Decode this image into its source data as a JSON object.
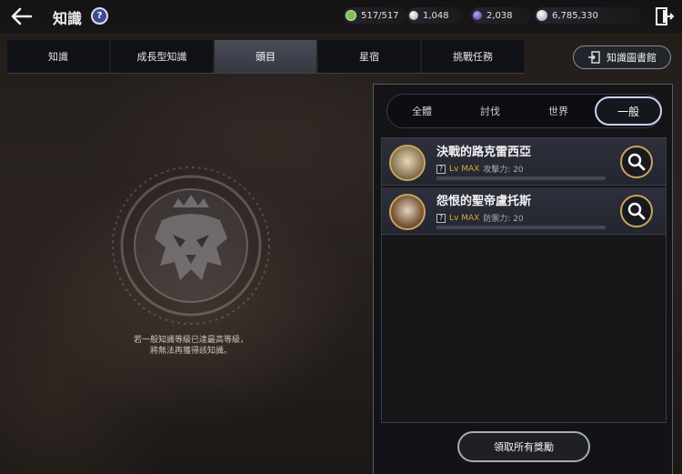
{
  "header": {
    "title": "知識",
    "help_glyph": "?"
  },
  "resources": [
    {
      "name": "energy",
      "value": "517/517",
      "color": "#7fbf5a"
    },
    {
      "name": "pearl",
      "value": "1,048",
      "color": "#d8d8d8"
    },
    {
      "name": "crystal",
      "value": "2,038",
      "color": "#6a4fc4"
    },
    {
      "name": "silver",
      "value": "6,785,330",
      "color": "#b8c4d8"
    }
  ],
  "tabs": [
    {
      "label": "知識",
      "active": false
    },
    {
      "label": "成長型知識",
      "active": false
    },
    {
      "label": "頭目",
      "active": true
    },
    {
      "label": "星宿",
      "active": false
    },
    {
      "label": "挑戰任務",
      "active": false
    }
  ],
  "library_button": "知識圖書館",
  "notice": {
    "line1": "若一般知識等級已達最高等級，",
    "line2": "將無法再獲得該知識。"
  },
  "filters": [
    {
      "label": "全體",
      "active": false
    },
    {
      "label": "討伐",
      "active": false
    },
    {
      "label": "世界",
      "active": false
    },
    {
      "label": "一般",
      "active": true
    }
  ],
  "bosses": [
    {
      "name": "決戰的路克雷西亞",
      "level": "Lv MAX",
      "stat": "攻擊力: 20",
      "icon": "boss-portrait-icon"
    },
    {
      "name": "怨恨的聖帝盧托斯",
      "level": "Lv MAX",
      "stat": "防禦力: 20",
      "icon": "boss-portrait-icon"
    }
  ],
  "claim_all_button": "領取所有獎勵",
  "colors": {
    "accent_gold": "#c9a55e",
    "level_gold": "#d6a93a",
    "active_filter_border": "#c7d2ee"
  }
}
